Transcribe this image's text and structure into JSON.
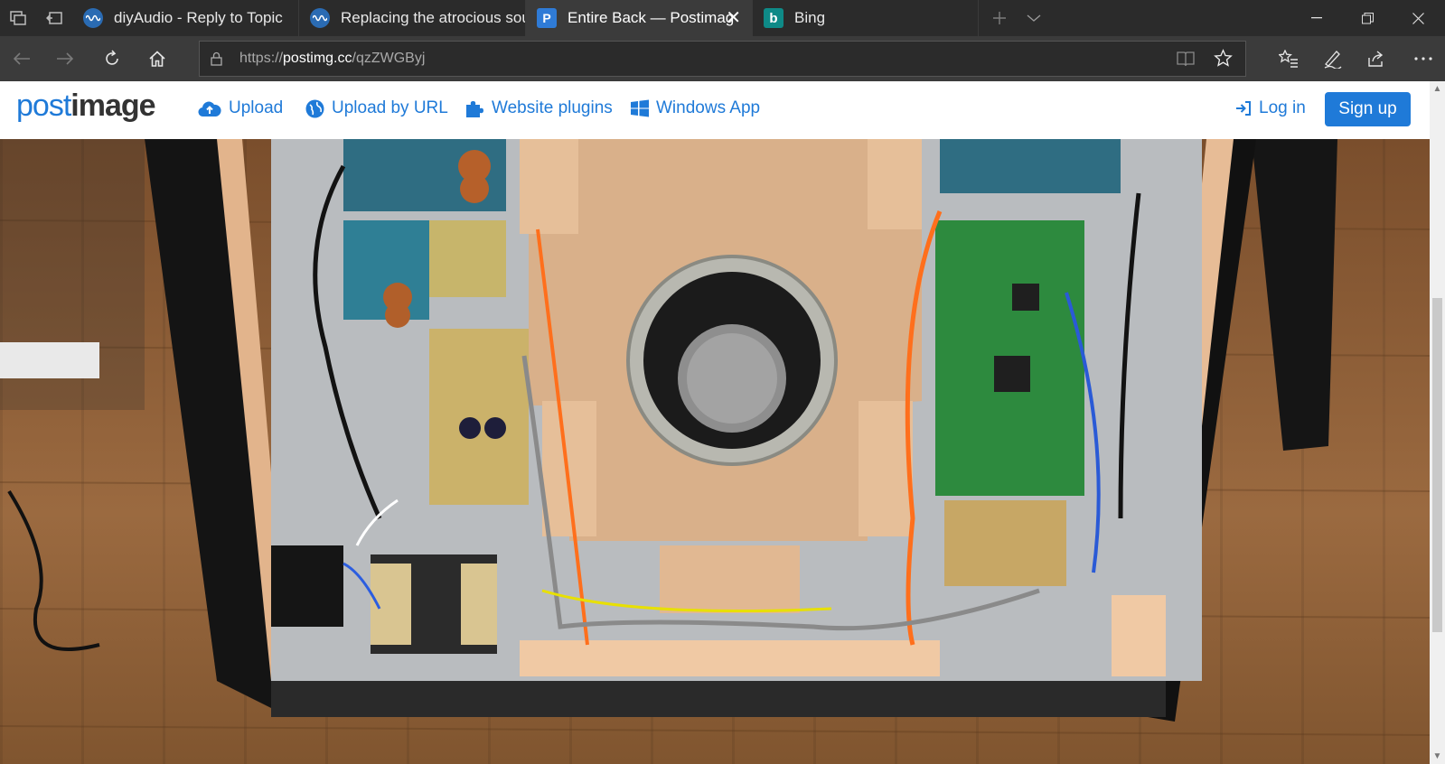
{
  "tabs": [
    {
      "title": "diyAudio - Reply to Topic",
      "favicon": "diyaudio-icon"
    },
    {
      "title": "Replacing the atrocious sou",
      "favicon": "diyaudio-icon"
    },
    {
      "title": "Entire Back — Postimag",
      "favicon": "postimage-icon",
      "active": true
    },
    {
      "title": "Bing",
      "favicon": "bing-icon"
    }
  ],
  "address_bar": {
    "prefix": "https://",
    "domain": "postimg.cc",
    "path": "/qzZWGByj"
  },
  "site": {
    "logo_post": "post",
    "logo_image": "image",
    "nav": {
      "upload": "Upload",
      "upload_by_url": "Upload by URL",
      "website_plugins": "Website plugins",
      "windows_app": "Windows App",
      "log_in": "Log in",
      "sign_up": "Sign up"
    }
  },
  "colors": {
    "accent": "#1f7ad8",
    "tab_bar": "#2b2b2b",
    "nav_bar": "#3b3b3b"
  }
}
